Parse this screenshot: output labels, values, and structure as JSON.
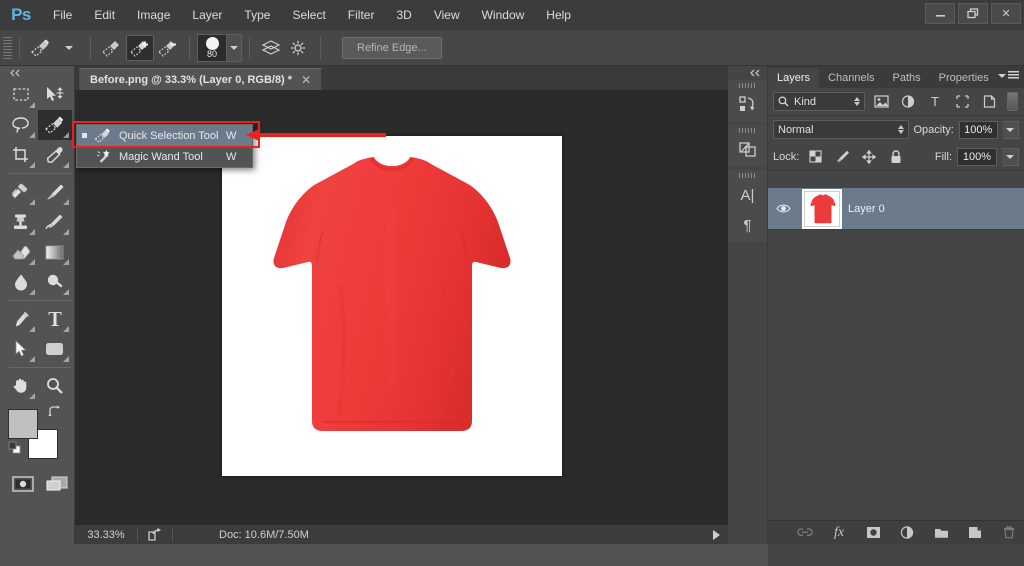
{
  "app": {
    "name": "Adobe Photoshop",
    "logo_text": "Ps",
    "logo_color": "#5fb4e5",
    "accent_red": "#e8231c",
    "selection_blue": "#6b7b8c"
  },
  "menubar": {
    "items": [
      {
        "label": "File",
        "name": "menu-file"
      },
      {
        "label": "Edit",
        "name": "menu-edit"
      },
      {
        "label": "Image",
        "name": "menu-image"
      },
      {
        "label": "Layer",
        "name": "menu-layer"
      },
      {
        "label": "Type",
        "name": "menu-type"
      },
      {
        "label": "Select",
        "name": "menu-select"
      },
      {
        "label": "Filter",
        "name": "menu-filter"
      },
      {
        "label": "3D",
        "name": "menu-3d"
      },
      {
        "label": "View",
        "name": "menu-view"
      },
      {
        "label": "Window",
        "name": "menu-window"
      },
      {
        "label": "Help",
        "name": "menu-help"
      }
    ],
    "window_controls": {
      "minimize": "minimize-icon",
      "restore": "restore-icon",
      "close": "✕"
    }
  },
  "options_bar": {
    "tool_preset": "quick-selection-tool-preset",
    "modes": [
      {
        "name": "new-selection-mode",
        "active": false
      },
      {
        "name": "add-to-selection-mode",
        "active": true
      },
      {
        "name": "subtract-from-selection-mode",
        "active": false
      }
    ],
    "brush_size": "80",
    "sample_all_layers": "sample-all-layers-icon",
    "auto_enhance": "auto-enhance-icon",
    "refine_edge_label": "Refine Edge..."
  },
  "toolbar": {
    "tools": [
      {
        "name": "rectangular-marquee-tool",
        "active": false
      },
      {
        "name": "move-tool",
        "active": false
      },
      {
        "name": "lasso-tool",
        "active": false
      },
      {
        "name": "quick-selection-tool",
        "active": true
      },
      {
        "name": "crop-tool",
        "active": false
      },
      {
        "name": "eyedropper-tool",
        "active": false
      },
      {
        "name": "spot-healing-brush-tool",
        "active": false
      },
      {
        "name": "brush-tool",
        "active": false
      },
      {
        "name": "clone-stamp-tool",
        "active": false
      },
      {
        "name": "history-brush-tool",
        "active": false
      },
      {
        "name": "eraser-tool",
        "active": false
      },
      {
        "name": "gradient-tool",
        "active": false
      },
      {
        "name": "blur-tool",
        "active": false
      },
      {
        "name": "dodge-tool",
        "active": false
      },
      {
        "name": "pen-tool",
        "active": false
      },
      {
        "name": "horizontal-type-tool",
        "active": false
      },
      {
        "name": "path-selection-tool",
        "active": false
      },
      {
        "name": "rectangle-tool",
        "active": false
      },
      {
        "name": "hand-tool",
        "active": false
      },
      {
        "name": "zoom-tool",
        "active": false
      }
    ],
    "foreground_color": "#c0c0c0",
    "background_color": "#ffffff",
    "quick_mask": "edit-in-quick-mask-mode-icon",
    "screen_mode": "change-screen-mode-icon"
  },
  "flyout_menu": {
    "items": [
      {
        "label": "Quick Selection Tool",
        "shortcut": "W",
        "selected": true,
        "icon": "quick-selection-tool-icon"
      },
      {
        "label": "Magic Wand Tool",
        "shortcut": "W",
        "selected": false,
        "icon": "magic-wand-tool-icon"
      }
    ],
    "annotation": "red-arrow-callout"
  },
  "document": {
    "tab_title": "Before.png @ 33.3% (Layer 0, RGB/8) *",
    "close_label": "✕",
    "canvas_bg": "#ffffff",
    "image_subject": "red-t-shirt"
  },
  "status_bar": {
    "zoom": "33.33%",
    "share_icon": "share-icon",
    "doc_info": "Doc: 10.6M/7.50M",
    "play_icon": "play-arrow-icon"
  },
  "icon_dock": {
    "collapse_label": "«",
    "groups": [
      {
        "icons": [
          {
            "name": "history-panel-icon",
            "glyph": "⇱"
          }
        ]
      },
      {
        "icons": [
          {
            "name": "adjustments-panel-icon",
            "glyph": "◪"
          }
        ]
      },
      {
        "icons": [
          {
            "name": "character-panel-icon",
            "glyph": "A|"
          },
          {
            "name": "paragraph-panel-icon",
            "glyph": "¶"
          }
        ]
      }
    ]
  },
  "layers_panel": {
    "tabs": [
      {
        "label": "Layers",
        "active": true
      },
      {
        "label": "Channels",
        "active": false
      },
      {
        "label": "Paths",
        "active": false
      },
      {
        "label": "Properties",
        "active": false
      }
    ],
    "menu_icon": "panel-menu-icon",
    "filter": {
      "kind_label": "Kind",
      "search_icon": "search-icon",
      "type_filters": [
        {
          "name": "filter-pixel-layers-icon",
          "glyph": "▣"
        },
        {
          "name": "filter-adjustment-layers-icon",
          "glyph": "◑"
        },
        {
          "name": "filter-type-layers-icon",
          "glyph": "T"
        },
        {
          "name": "filter-shape-layers-icon",
          "glyph": "▢"
        },
        {
          "name": "filter-smart-objects-icon",
          "glyph": "◳"
        }
      ],
      "toggle_name": "filter-toggle-switch"
    },
    "blend_mode": "Normal",
    "opacity_label": "Opacity:",
    "opacity_value": "100%",
    "lock_label": "Lock:",
    "lock_icons": [
      {
        "name": "lock-transparent-pixels-icon",
        "glyph": "▚"
      },
      {
        "name": "lock-image-pixels-icon",
        "glyph": "🖌"
      },
      {
        "name": "lock-position-icon",
        "glyph": "✥"
      },
      {
        "name": "lock-all-icon",
        "glyph": "🔒"
      }
    ],
    "fill_label": "Fill:",
    "fill_value": "100%",
    "layers": [
      {
        "name": "Layer 0",
        "visible": true,
        "selected": true,
        "thumbnail": "red-t-shirt-thumbnail"
      }
    ],
    "bottom_buttons": [
      {
        "name": "link-layers-button",
        "glyph": "⛓",
        "dim": true
      },
      {
        "name": "add-layer-style-button",
        "glyph": "fx",
        "dim": false
      },
      {
        "name": "add-layer-mask-button",
        "glyph": "▣",
        "dim": false
      },
      {
        "name": "new-fill-adjustment-layer-button",
        "glyph": "◑",
        "dim": false
      },
      {
        "name": "new-group-button",
        "glyph": "📁",
        "dim": false
      },
      {
        "name": "new-layer-button",
        "glyph": "◨",
        "dim": false
      },
      {
        "name": "delete-layer-button",
        "glyph": "🗑",
        "dim": true
      }
    ]
  }
}
